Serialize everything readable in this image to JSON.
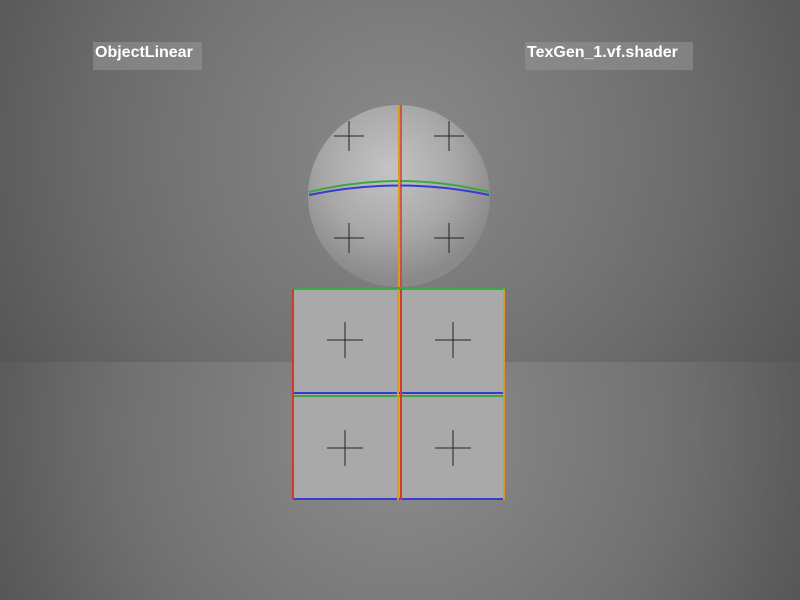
{
  "viewport": {
    "mode_label": "ObjectLinear",
    "shader_label": "TexGen_1.vf.shader"
  },
  "colors": {
    "background_wall": "#6e6e6e",
    "floor": "#707070",
    "object_fill": "#a9a9a9",
    "axis_red": "#d23a2a",
    "axis_green": "#3aa845",
    "axis_blue": "#3a3ad0",
    "axis_orange": "#d89a20",
    "marker": "#222222"
  }
}
